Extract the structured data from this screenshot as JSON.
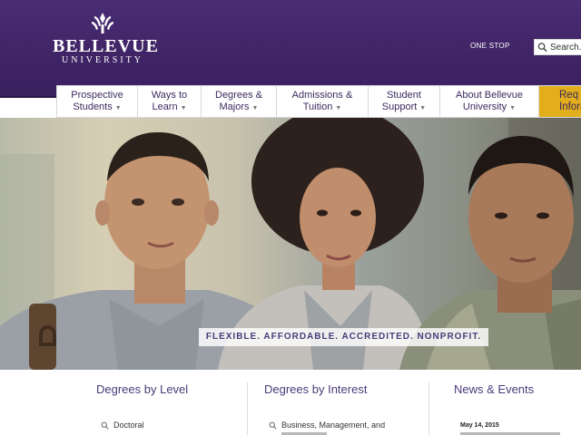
{
  "header": {
    "logo_name": "BELLEVUE",
    "logo_sub": "UNIVERSITY",
    "one_stop": "ONE STOP",
    "search_placeholder": "Search..."
  },
  "nav": {
    "items": [
      {
        "line1": "Prospective",
        "line2": "Students"
      },
      {
        "line1": "Ways to",
        "line2": "Learn"
      },
      {
        "line1": "Degrees &",
        "line2": "Majors"
      },
      {
        "line1": "Admissions &",
        "line2": "Tuition"
      },
      {
        "line1": "Student",
        "line2": "Support"
      },
      {
        "line1": "About Bellevue",
        "line2": "University"
      }
    ],
    "cta_line1": "Req",
    "cta_line2": "Inform"
  },
  "hero": {
    "tagline": "FLEXIBLE. AFFORDABLE. ACCREDITED. NONPROFIT."
  },
  "columns": {
    "level_title": "Degrees by Level",
    "level_link": "Doctoral",
    "interest_title": "Degrees by Interest",
    "interest_link": "Business, Management, and",
    "news_title": "News & Events",
    "news_date": "May 14, 2015"
  },
  "colors": {
    "header_purple": "#432769",
    "accent_gold": "#e2ae1b",
    "text_purple": "#4b3b7a"
  }
}
